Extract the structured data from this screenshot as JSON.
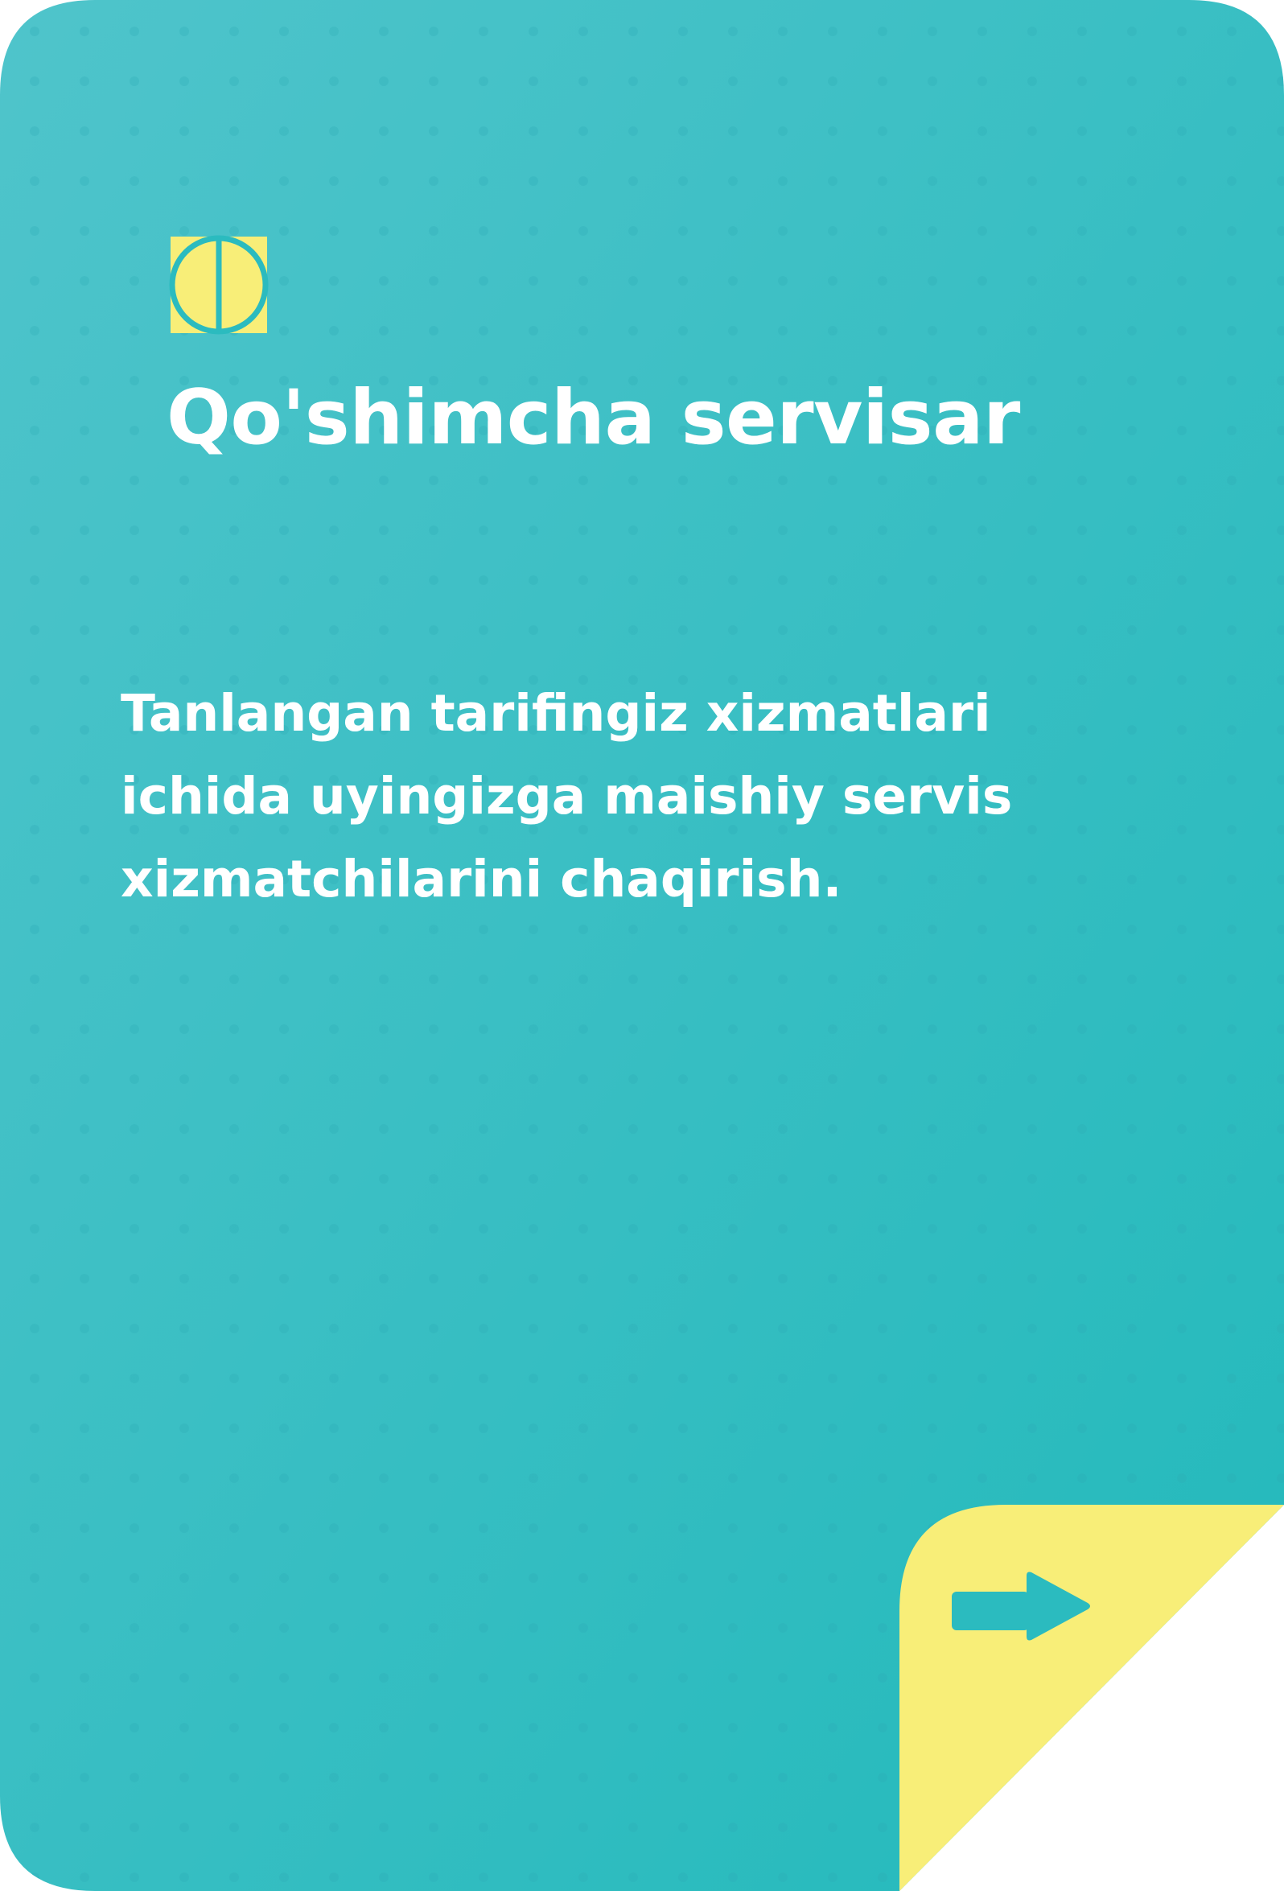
{
  "card": {
    "title": "Qo'shimcha servisar",
    "description_lines": [
      "Tanlangan tarifingiz xizmatlari",
      "ichida uyingizga maishiy servis",
      "xizmatchilarini chaqirish."
    ],
    "colors": {
      "background_start": "#4fc4cb",
      "background_end": "#22b9bb",
      "dot_pattern": "#2aa8b4",
      "accent_yellow": "#f8ee78",
      "arrow": "#2bbbbf",
      "text": "#ffffff"
    }
  },
  "logo": {
    "icon": "circle-split-logo-icon"
  },
  "navigation": {
    "next_icon": "arrow-right-icon"
  }
}
